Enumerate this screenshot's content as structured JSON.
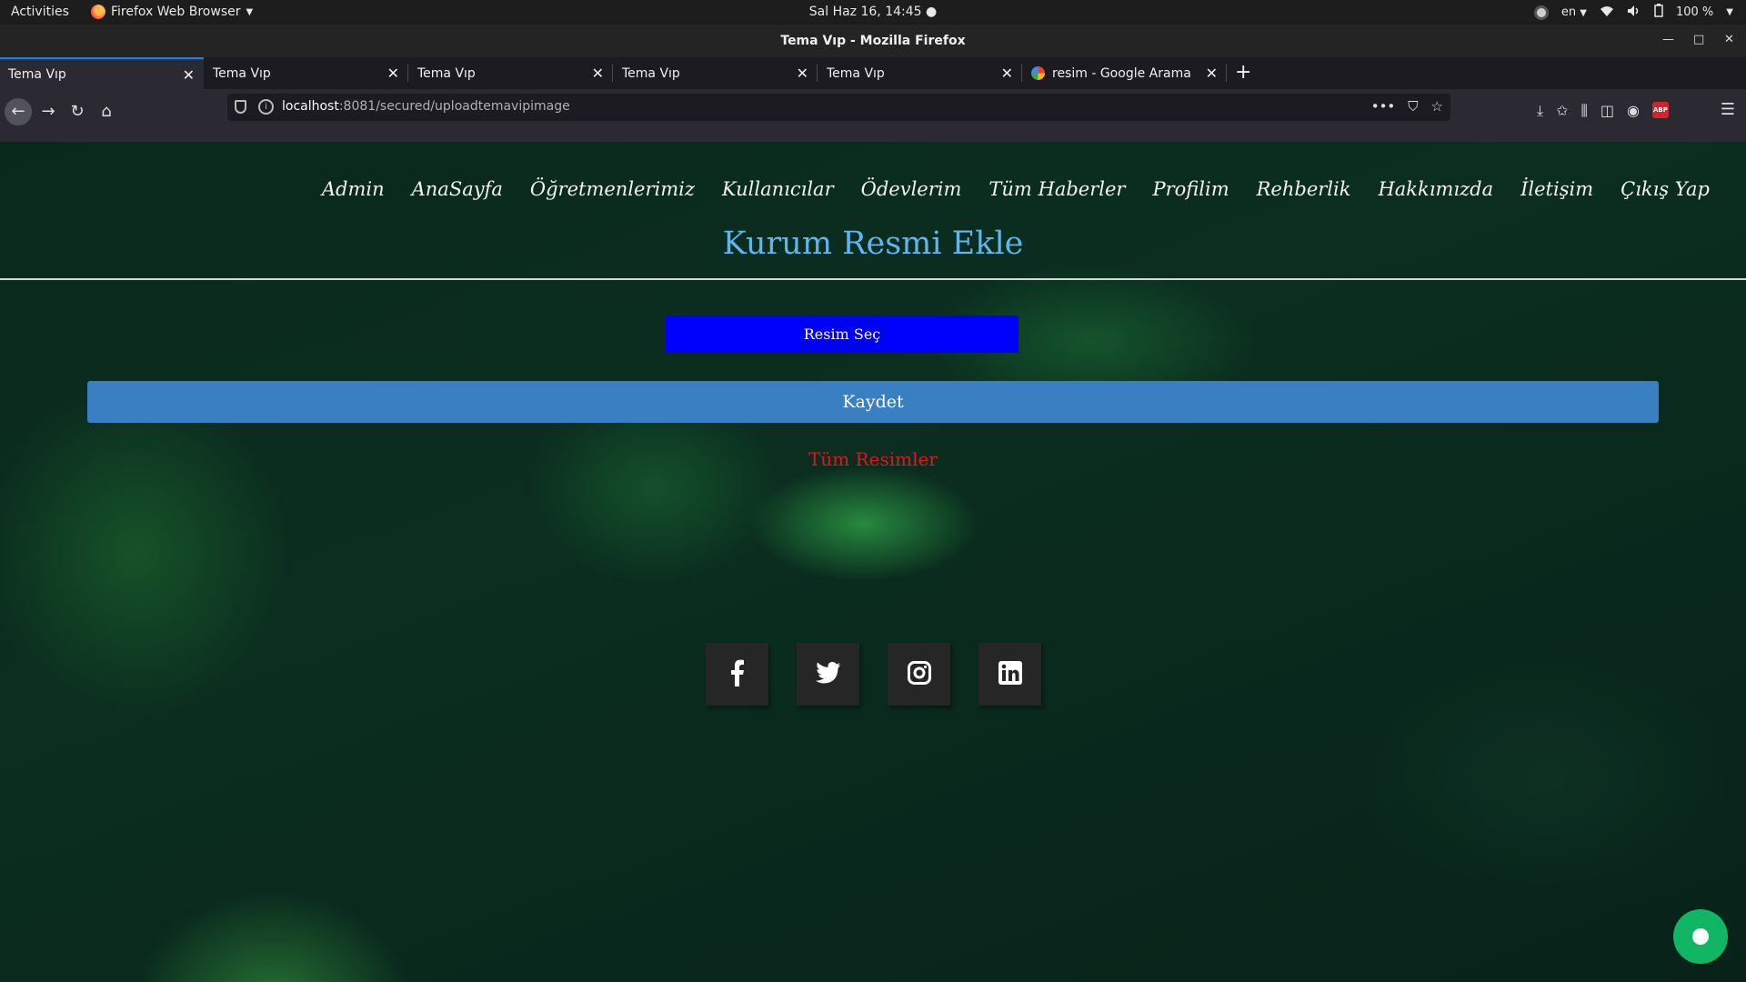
{
  "topbar": {
    "activities": "Activities",
    "app_name": "Firefox Web Browser",
    "clock": "Sal Haz 16, 14:45",
    "language": "en",
    "battery": "100 %"
  },
  "window": {
    "title": "Tema Vıp - Mozilla Firefox"
  },
  "tabs": [
    {
      "label": "Tema Vıp"
    },
    {
      "label": "Tema Vıp"
    },
    {
      "label": "Tema Vıp"
    },
    {
      "label": "Tema Vıp"
    },
    {
      "label": "Tema Vıp"
    },
    {
      "label": "resim - Google Arama"
    }
  ],
  "urlbar": {
    "host": "localhost",
    "path": ":8081/secured/uploadtemavipimage"
  },
  "page": {
    "menu": [
      "Admin",
      "AnaSayfa",
      "Öğretmenlerimiz",
      "Kullanıcılar",
      "Ödevlerim",
      "Tüm Haberler",
      "Profilim",
      "Rehberlik",
      "Hakkımızda",
      "İletişim",
      "Çıkış Yap"
    ],
    "title": "Kurum Resmi Ekle",
    "choose_button": "Resim Seç",
    "save_button": "Kaydet",
    "all_images_link": "Tüm Resimler",
    "social": [
      "facebook-icon",
      "twitter-icon",
      "instagram-icon",
      "linkedin-icon"
    ]
  },
  "colors": {
    "title": "#5fb6ee",
    "choose_button": "#0000ff",
    "save_button": "#3a7fc1",
    "all_images_link": "#e0161a",
    "chat_button": "#10b664"
  }
}
